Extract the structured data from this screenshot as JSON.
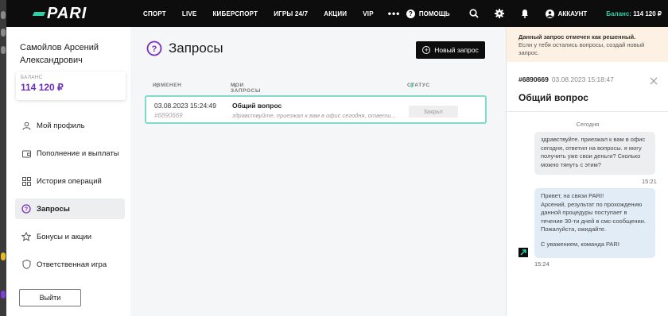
{
  "topbar": {
    "logo": "PARI",
    "nav": [
      "СПОРТ",
      "LIVE",
      "КИБЕРСПОРТ",
      "ИГРЫ 24/7",
      "АКЦИИ",
      "VIP"
    ],
    "more": "•••",
    "help_label": "ПОМОЩЬ",
    "account_label": "АККАУНТ",
    "balance_label": "Баланс:",
    "balance_value": "114 120 ₽",
    "icons": [
      "help-icon",
      "search-icon",
      "gear-icon",
      "bell-icon",
      "account-icon"
    ]
  },
  "sidebar": {
    "user_name": "Самойлов Арсений Александрович",
    "balance_label": "БАЛАНС",
    "balance_value": "114 120 ₽",
    "items": [
      {
        "label": "Мой профиль",
        "icon": "user-icon"
      },
      {
        "label": "Пополнение и выплаты",
        "icon": "wallet-icon"
      },
      {
        "label": "История операций",
        "icon": "grid-icon"
      },
      {
        "label": "Запросы",
        "icon": "question-icon",
        "active": true
      },
      {
        "label": "Бонусы и акции",
        "icon": "star-icon"
      },
      {
        "label": "Ответственная игра",
        "icon": "shield-icon"
      }
    ],
    "logout_label": "Выйти"
  },
  "main": {
    "title": "Запросы",
    "new_button": "Новый запрос",
    "columns": {
      "changed": "ИЗМЕНЕН",
      "my_requests": "МОИ ЗАПРОСЫ",
      "status": "СТАТУС"
    },
    "rows": [
      {
        "date": "03.08.2023 15:24:49",
        "id": "#6890669",
        "subject": "Общий вопрос",
        "snippet": "здравствуйте, приезжал к вам в офис сегодня, ответи...",
        "status": "Закрыт"
      }
    ]
  },
  "panel": {
    "notice_title": "Данный запрос отмечен как решенный.",
    "notice_text": "Если у тебя остались вопросы, создай новый запрос.",
    "ticket_id": "#6890669",
    "ticket_date": "03.08.2023 15:18:47",
    "ticket_title": "Общий вопрос",
    "day_label": "Сегодня",
    "messages": [
      {
        "from": "user",
        "text": "здравствуйте. приезжал к вам в офис сегодня, ответил на вопросы. я могу получить уже свои деньги? Сколько можно тянуть с этим?",
        "time": "15:21"
      },
      {
        "from": "agent",
        "line1": "Привет, на связи PARI!",
        "line2": "Арсений, результат по прохождению данной процедуры поступает в течение 30-ти дней в смс-сообщении. Пожалуйста, ожидайте.",
        "line3": "С уважением, команда PARI",
        "time": "15:24"
      }
    ]
  }
}
